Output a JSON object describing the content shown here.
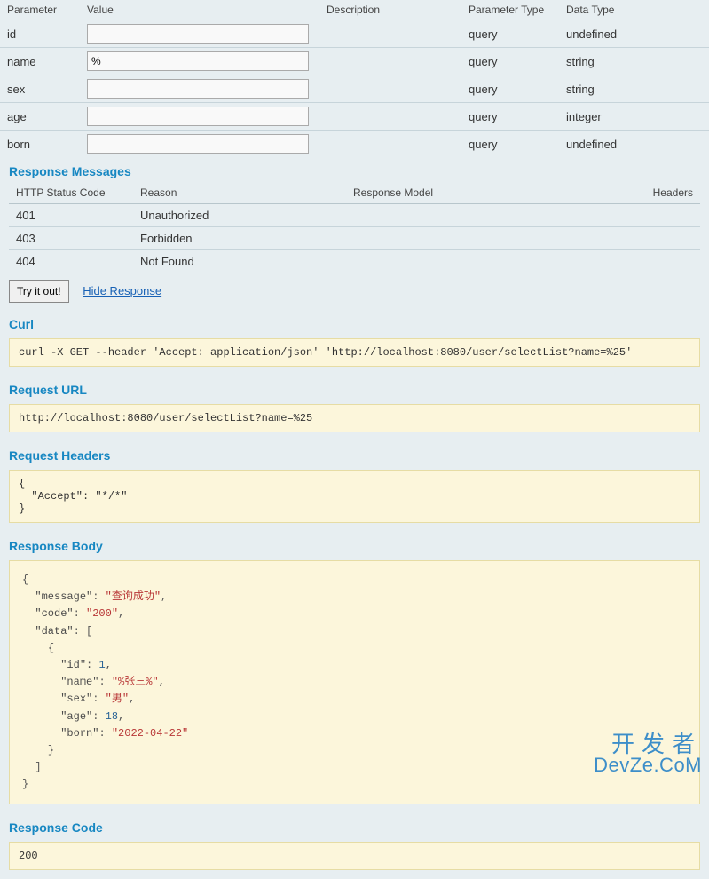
{
  "params_table": {
    "headers": {
      "parameter": "Parameter",
      "value": "Value",
      "description": "Description",
      "parameter_type": "Parameter Type",
      "data_type": "Data Type"
    },
    "rows": [
      {
        "parameter": "id",
        "value": "",
        "parameter_type": "query",
        "data_type": "undefined"
      },
      {
        "parameter": "name",
        "value": "%",
        "parameter_type": "query",
        "data_type": "string"
      },
      {
        "parameter": "sex",
        "value": "",
        "parameter_type": "query",
        "data_type": "string"
      },
      {
        "parameter": "age",
        "value": "",
        "parameter_type": "query",
        "data_type": "integer"
      },
      {
        "parameter": "born",
        "value": "",
        "parameter_type": "query",
        "data_type": "undefined"
      }
    ]
  },
  "response_messages": {
    "title": "Response Messages",
    "headers": {
      "code": "HTTP Status Code",
      "reason": "Reason",
      "model": "Response Model",
      "headers": "Headers"
    },
    "rows": [
      {
        "code": "401",
        "reason": "Unauthorized"
      },
      {
        "code": "403",
        "reason": "Forbidden"
      },
      {
        "code": "404",
        "reason": "Not Found"
      }
    ]
  },
  "actions": {
    "try_label": "Try it out!",
    "hide_label": "Hide Response"
  },
  "curl": {
    "title": "Curl",
    "value": "curl -X GET --header 'Accept: application/json' 'http://localhost:8080/user/selectList?name=%25'"
  },
  "request_url": {
    "title": "Request URL",
    "value": "http://localhost:8080/user/selectList?name=%25"
  },
  "request_headers": {
    "title": "Request Headers",
    "value": "{\n  \"Accept\": \"*/*\"\n}"
  },
  "response_body": {
    "title": "Response Body",
    "json": {
      "message": "查询成功",
      "code": "200",
      "data": [
        {
          "id": 1,
          "name": "%张三%",
          "sex": "男",
          "age": 18,
          "born": "2022-04-22"
        }
      ]
    }
  },
  "response_code": {
    "title": "Response Code",
    "value": "200"
  },
  "watermark": {
    "line1": "开发者",
    "line2": "DevZe.CoM"
  }
}
